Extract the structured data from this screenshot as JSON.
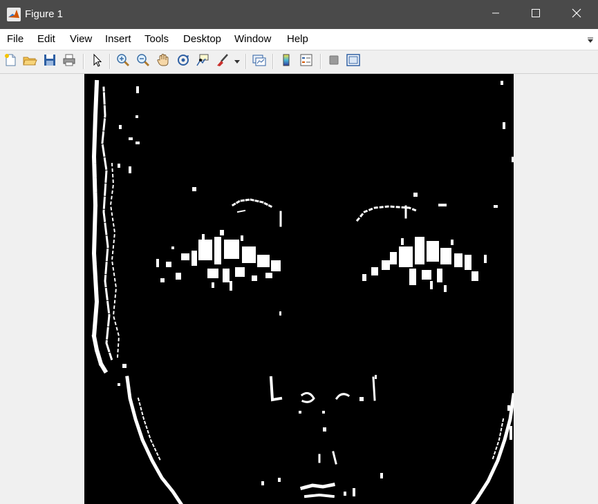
{
  "window": {
    "title": "Figure 1",
    "controls": {
      "minimize": "minimize",
      "maximize": "maximize",
      "close": "close"
    }
  },
  "menu": {
    "items": [
      "File",
      "Edit",
      "View",
      "Insert",
      "Tools",
      "Desktop",
      "Window",
      "Help"
    ]
  },
  "toolbar": {
    "buttons": [
      {
        "name": "new-figure-icon"
      },
      {
        "name": "open-file-icon"
      },
      {
        "name": "save-icon"
      },
      {
        "name": "print-icon"
      },
      {
        "name": "edit-plot-arrow-icon"
      },
      {
        "name": "zoom-in-icon"
      },
      {
        "name": "zoom-out-icon"
      },
      {
        "name": "pan-hand-icon"
      },
      {
        "name": "rotate-3d-icon"
      },
      {
        "name": "data-cursor-icon"
      },
      {
        "name": "brush-icon"
      },
      {
        "name": "link-plot-icon"
      },
      {
        "name": "colorbar-icon"
      },
      {
        "name": "legend-icon"
      },
      {
        "name": "hide-plot-tools-icon"
      },
      {
        "name": "show-plot-tools-icon"
      }
    ]
  },
  "image": {
    "description_colors": {
      "background": "#000000",
      "edges": "#ffffff"
    }
  },
  "colors": {
    "titlebar": "#4a4a4a",
    "menubar": "#ffffff",
    "toolbar": "#f0f0f0"
  }
}
